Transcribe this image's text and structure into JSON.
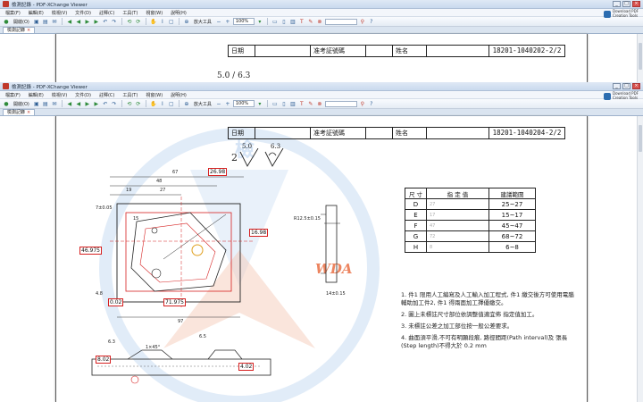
{
  "window": {
    "title": "檢測記錄 - PDF-XChange Viewer",
    "tab_label": "檢測記錄",
    "menu": [
      "檔案(F)",
      "編輯(E)",
      "檢視(V)",
      "文件(D)",
      "註釋(C)",
      "工具(T)",
      "視窗(W)",
      "說明(H)"
    ],
    "toolbar": {
      "open_label": "開啟(O)",
      "zoom_tool_label": "放大工具",
      "zoom_value": "100%"
    },
    "promo_text": "Download PDF Creation Tools"
  },
  "doc_top": {
    "header": {
      "date_label": "日期",
      "exam_label": "准考証號碼",
      "name_label": "姓名",
      "code": "18201-1040202-2/2"
    },
    "finish": "5.0 / 6.3"
  },
  "doc": {
    "header": {
      "date_label": "日期",
      "exam_label": "准考証號碼",
      "name_label": "姓名",
      "code": "18201-1040204-2/2"
    },
    "finish_prefix": "2",
    "finish_a": "5.0",
    "finish_b": "6.3",
    "spec_table": {
      "headers": [
        "尺 寸",
        "指 定 值",
        "建議範圍"
      ],
      "rows": [
        {
          "dim": "D",
          "value": "27",
          "range": "25~27"
        },
        {
          "dim": "E",
          "value": "17",
          "range": "15~17"
        },
        {
          "dim": "F",
          "value": "47",
          "range": "45~47"
        },
        {
          "dim": "G",
          "value": "72",
          "range": "68~72"
        },
        {
          "dim": "H",
          "value": "8",
          "range": "6~8"
        }
      ]
    },
    "notes": [
      "1. 件1 限用人工編寫及人工輸入加工程式, 件1 繳交後方可使用電腦輔助加工件2, 件1 得兩面加工擇優繳交。",
      "2. 圖上未標註尺寸部位依調整值適宜佈 指定值加工。",
      "3. 未標註公差之加工部位按一般公差要求。",
      "4. 曲面須平滑,不可有明顯段痕, 路徑間距(Path interval)及 張長 (Step length)不得大於 0.2 mm"
    ],
    "watermark_brand": "WDA",
    "watermark_text": "檢",
    "dims": {
      "d67": "67",
      "d48": "48",
      "d19": "19",
      "d27": "27",
      "d15": "15",
      "d97": "97",
      "box_top": "26.98",
      "box_right": "16.98",
      "box_left": "46.975",
      "box_bottom": "71.975",
      "box_tol": "0.02",
      "box_bl": "8.02",
      "box_br": "4.02",
      "r_label": "R12.5±0.15",
      "depth_label": "14±0.15",
      "r65": "6.5",
      "r63": "6.3",
      "chamfer": "1×45°",
      "dim48": "4.8",
      "dim75": "7±0.05"
    }
  }
}
